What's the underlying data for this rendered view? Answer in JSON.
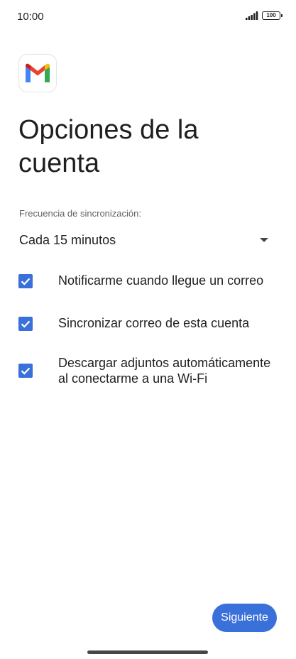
{
  "status_bar": {
    "time": "10:00",
    "battery_level": "100",
    "icons": [
      "signal-icon",
      "battery-icon"
    ]
  },
  "app": {
    "logo_icon": "gmail-logo-icon"
  },
  "page": {
    "title": "Opciones de la cuenta"
  },
  "sync": {
    "label": "Frecuencia de sincronización:",
    "selected_value": "Cada 15 minutos"
  },
  "options": [
    {
      "label": "Notificarme cuando llegue un correo",
      "checked": true
    },
    {
      "label": "Sincronizar correo de esta cuenta",
      "checked": true
    },
    {
      "label": "Descargar adjuntos automáticamente al conectarme a una Wi-Fi",
      "checked": true
    }
  ],
  "actions": {
    "next_label": "Siguiente"
  },
  "colors": {
    "accent": "#3a70d9",
    "text_primary": "#1f1f1f",
    "text_secondary": "#5f6368"
  }
}
